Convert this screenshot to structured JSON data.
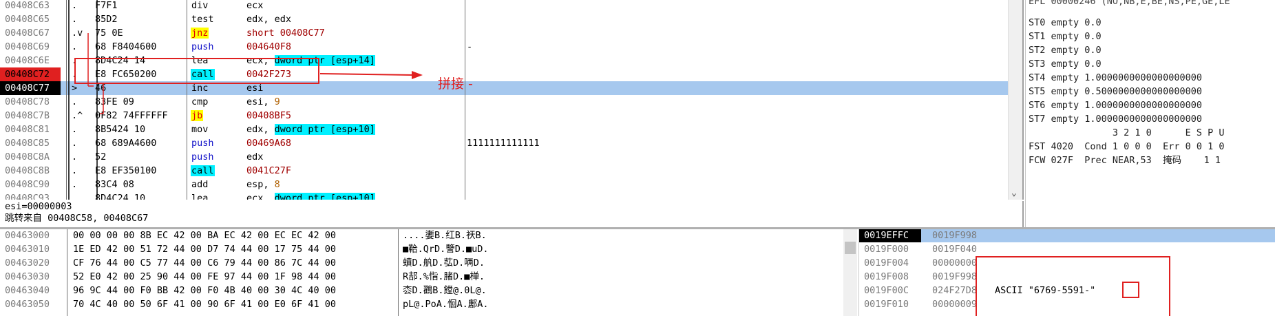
{
  "disasm": {
    "rows": [
      {
        "addr": "00408C63",
        "mark": ".",
        "hex": "F7F1",
        "mnem": "div",
        "mnem_style": "",
        "op": "ecx",
        "op_hl": "",
        "op_tail": "",
        "op_style": "",
        "comment": "",
        "addr_style": ""
      },
      {
        "addr": "00408C65",
        "mark": ".",
        "hex": "85D2",
        "mnem": "test",
        "mnem_style": "",
        "op": "edx, edx",
        "op_hl": "",
        "op_tail": "",
        "op_style": "",
        "comment": "",
        "addr_style": ""
      },
      {
        "addr": "00408C67",
        "mark": ".v",
        "hex": "75 0E",
        "mnem": "jnz",
        "mnem_style": "jcc",
        "op": "short 00408C77",
        "op_hl": "",
        "op_tail": "",
        "op_style": "red",
        "comment": "",
        "addr_style": ""
      },
      {
        "addr": "00408C69",
        "mark": ".",
        "hex": "68 F8404600",
        "mnem": "push",
        "mnem_style": "push",
        "op": "004640F8",
        "op_hl": "",
        "op_tail": "",
        "op_style": "red",
        "comment": "-",
        "addr_style": ""
      },
      {
        "addr": "00408C6E",
        "mark": ".",
        "hex": "8D4C24 14",
        "mnem": "lea",
        "mnem_style": "",
        "op": "ecx, ",
        "op_hl": "dword ptr [esp+14]",
        "op_tail": "",
        "op_style": "",
        "comment": "",
        "addr_style": ""
      },
      {
        "addr": "00408C72",
        "mark": ".",
        "hex": "E8 FC650200",
        "mnem": "call",
        "mnem_style": "call",
        "op": "0042F273",
        "op_hl": "",
        "op_tail": "",
        "op_style": "red",
        "comment": "",
        "addr_style": "bp"
      },
      {
        "addr": "00408C77",
        "mark": ">",
        "hex": "46",
        "mnem": "inc",
        "mnem_style": "",
        "op": "esi",
        "op_hl": "",
        "op_tail": "",
        "op_style": "",
        "comment": "",
        "addr_style": "eip"
      },
      {
        "addr": "00408C78",
        "mark": ".",
        "hex": "83FE 09",
        "mnem": "cmp",
        "mnem_style": "",
        "op": "esi, ",
        "op_hl": "",
        "op_tail": "9",
        "op_style": "",
        "comment": "",
        "addr_style": ""
      },
      {
        "addr": "00408C7B",
        "mark": ".^",
        "hex": "0F82 74FFFFFF",
        "mnem": "jb",
        "mnem_style": "jcc",
        "op": "00408BF5",
        "op_hl": "",
        "op_tail": "",
        "op_style": "red",
        "comment": "",
        "addr_style": ""
      },
      {
        "addr": "00408C81",
        "mark": ".",
        "hex": "8B5424 10",
        "mnem": "mov",
        "mnem_style": "",
        "op": "edx, ",
        "op_hl": "dword ptr [esp+10]",
        "op_tail": "",
        "op_style": "",
        "comment": "",
        "addr_style": ""
      },
      {
        "addr": "00408C85",
        "mark": ".",
        "hex": "68 689A4600",
        "mnem": "push",
        "mnem_style": "push",
        "op": "00469A68",
        "op_hl": "",
        "op_tail": "",
        "op_style": "red",
        "comment": "1111111111111",
        "addr_style": ""
      },
      {
        "addr": "00408C8A",
        "mark": ".",
        "hex": "52",
        "mnem": "push",
        "mnem_style": "push",
        "op": "edx",
        "op_hl": "",
        "op_tail": "",
        "op_style": "",
        "comment": "",
        "addr_style": ""
      },
      {
        "addr": "00408C8B",
        "mark": ".",
        "hex": "E8 EF350100",
        "mnem": "call",
        "mnem_style": "call",
        "op": "0041C27F",
        "op_hl": "",
        "op_tail": "",
        "op_style": "red",
        "comment": "",
        "addr_style": ""
      },
      {
        "addr": "00408C90",
        "mark": ".",
        "hex": "83C4 08",
        "mnem": "add",
        "mnem_style": "",
        "op": "esp, ",
        "op_hl": "",
        "op_tail": "8",
        "op_style": "",
        "comment": "",
        "addr_style": ""
      },
      {
        "addr": "00408C93",
        "mark": ".",
        "hex": "8D4C24 10",
        "mnem": "lea",
        "mnem_style": "",
        "op": "ecx, ",
        "op_hl": "dword ptr [esp+10]",
        "op_tail": "",
        "op_style": "",
        "comment": "",
        "addr_style": ""
      }
    ],
    "selected_row": 6
  },
  "info": {
    "line1": "esi=00000003",
    "line2": "跳转来自 00408C58, 00408C67"
  },
  "annotation": {
    "text": "拼接 -",
    "color": "#e02020"
  },
  "registers": {
    "efl": "EFL 00000246 (NO,NB,E,BE,NS,PE,GE,LE",
    "fpu": [
      "ST0 empty 0.0",
      "ST1 empty 0.0",
      "ST2 empty 0.0",
      "ST3 empty 0.0",
      "ST4 empty 1.0000000000000000000",
      "ST5 empty 0.5000000000000000000",
      "ST6 empty 1.0000000000000000000",
      "ST7 empty 1.0000000000000000000"
    ],
    "bits_header": "               3 2 1 0      E S P U",
    "fst": "FST 4020  Cond 1 0 0 0  Err 0 0 1 0",
    "fcw": "FCW 027F  Prec NEAR,53  掩码    1 1"
  },
  "dump": {
    "rows": [
      {
        "addr": "00463000",
        "hex": "00 00 00 00 8B EC 42 00 BA EC 42 00 EC EC 42 00",
        "ascii": "....嬱B.红B.祆B."
      },
      {
        "addr": "00463010",
        "hex": "1E ED 42 00 51 72 44 00 D7 74 44 00 17 75 44 00",
        "ascii": "■鞈.QrD.譼D.■uD."
      },
      {
        "addr": "00463020",
        "hex": "CF 76 44 00 C5 77 44 00 C6 79 44 00 86 7C 44 00",
        "ascii": "蟦D.舧D.苰D.唡D."
      },
      {
        "addr": "00463030",
        "hex": "52 E0 42 00 25 90 44 00 FE 97 44 00 1F 98 44 00",
        "ascii": "R郆.%恉.䐗D.■椫."
      },
      {
        "addr": "00463040",
        "hex": "96 9C 44 00 F0 BB 42 00 F0 4B 40 00 30 4C 40 00",
        "ascii": "枩D.鸐B.饄@.0L@."
      },
      {
        "addr": "00463050",
        "hex": "70 4C 40 00 50 6F 41 00 90 6F 41 00 E0 6F 41 00",
        "ascii": "pL@.PoA.恛A.鄌A."
      }
    ]
  },
  "stack": {
    "rows": [
      {
        "addr": "0019EFFC",
        "val": "0019F998",
        "comment": "",
        "top": true,
        "sel": true
      },
      {
        "addr": "0019F000",
        "val": "0019F040",
        "comment": "",
        "top": false,
        "sel": false
      },
      {
        "addr": "0019F004",
        "val": "00000000",
        "comment": "",
        "top": false,
        "sel": false
      },
      {
        "addr": "0019F008",
        "val": "0019F998",
        "comment": "",
        "top": false,
        "sel": false
      },
      {
        "addr": "0019F00C",
        "val": "024F27D8",
        "comment": "ASCII \"6769-5591-\"",
        "top": false,
        "sel": false
      },
      {
        "addr": "0019F010",
        "val": "00000009",
        "comment": "",
        "top": false,
        "sel": false
      }
    ]
  }
}
